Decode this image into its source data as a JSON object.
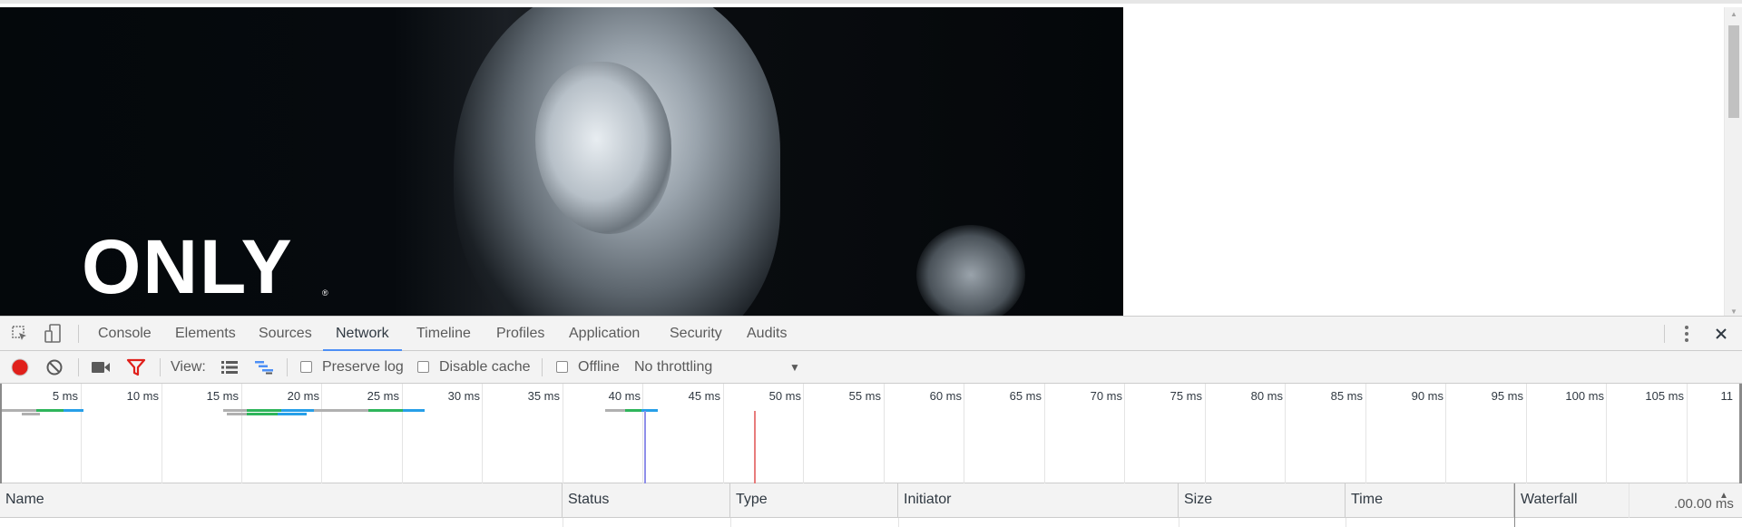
{
  "page": {
    "logo_text": "ONLY",
    "logo_mark": "®"
  },
  "devtools": {
    "tabs": [
      {
        "label": "Console",
        "active": false
      },
      {
        "label": "Elements",
        "active": false
      },
      {
        "label": "Sources",
        "active": false
      },
      {
        "label": "Network",
        "active": true
      },
      {
        "label": "Timeline",
        "active": false
      },
      {
        "label": "Profiles",
        "active": false
      },
      {
        "label": "Application",
        "active": false
      },
      {
        "label": "Security",
        "active": false
      },
      {
        "label": "Audits",
        "active": false
      }
    ],
    "toolbar": {
      "view_label": "View:",
      "preserve_log": "Preserve log",
      "disable_cache": "Disable cache",
      "offline": "Offline",
      "throttling": "No throttling"
    },
    "overview": {
      "ticks": [
        "5 ms",
        "10 ms",
        "15 ms",
        "20 ms",
        "25 ms",
        "30 ms",
        "35 ms",
        "40 ms",
        "45 ms",
        "50 ms",
        "55 ms",
        "60 ms",
        "65 ms",
        "70 ms",
        "75 ms",
        "80 ms",
        "85 ms",
        "90 ms",
        "95 ms",
        "100 ms",
        "105 ms",
        "11"
      ]
    },
    "columns": [
      "Name",
      "Status",
      "Type",
      "Initiator",
      "Size",
      "Time",
      "Waterfall"
    ],
    "waterfall_time": ".00.00 ms"
  },
  "colors": {
    "accent": "#4d8ff5",
    "record": "#e0201b",
    "filter": "#e0201b",
    "bar_green": "#2fb55b",
    "bar_blue": "#279fe8",
    "bar_gray": "#b0b0b0",
    "load_line": "#e87c7c",
    "dom_line": "#8f8fe9"
  }
}
